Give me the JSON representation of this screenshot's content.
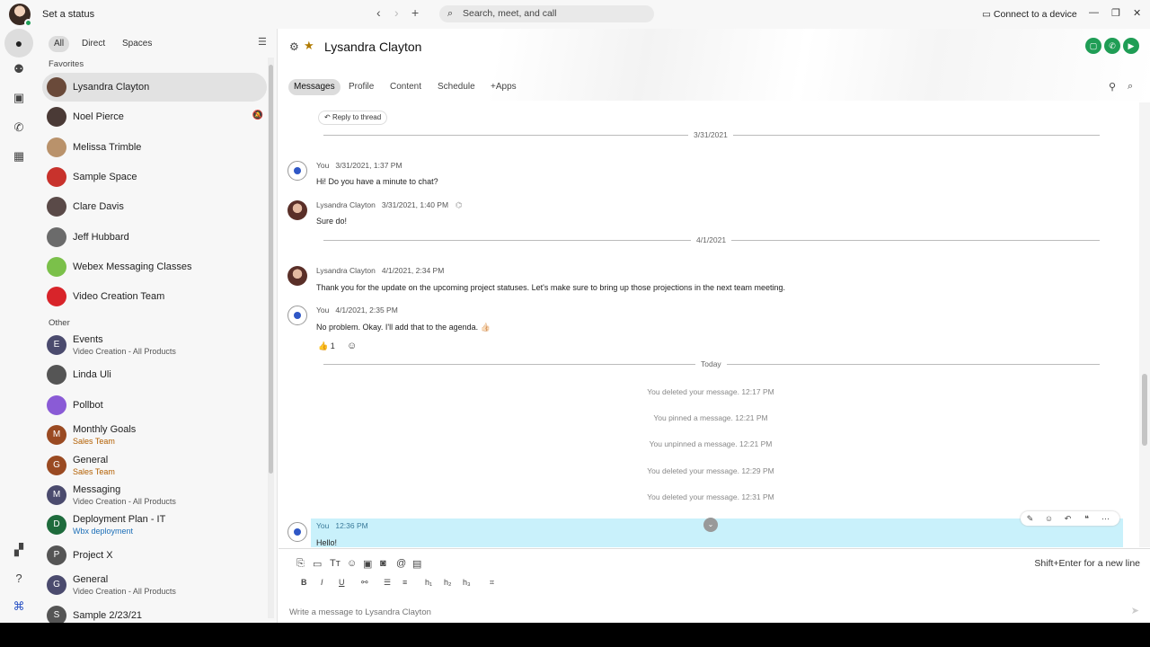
{
  "titlebar": {
    "set_status": "Set a status",
    "search_placeholder": "Search, meet, and call",
    "connect": "Connect to a device"
  },
  "sidebar": {
    "filters": [
      "All",
      "Direct",
      "Spaces"
    ],
    "favorites_label": "Favorites",
    "other_label": "Other",
    "favorites": [
      {
        "name": "Lysandra Clayton",
        "selected": true,
        "avatar_color": "#6a4a3a"
      },
      {
        "name": "Noel Pierce",
        "muted": true,
        "avatar_color": "#4a3a36"
      },
      {
        "name": "Melissa Trimble",
        "avatar_color": "#b9926b"
      },
      {
        "name": "Sample Space",
        "avatar_color": "#c8322c"
      },
      {
        "name": "Clare Davis",
        "avatar_color": "#5a4a48"
      },
      {
        "name": "Jeff Hubbard",
        "avatar_color": "#6b6b6b"
      },
      {
        "name": "Webex Messaging Classes",
        "avatar_color": "#7bc04a"
      },
      {
        "name": "Video Creation Team",
        "avatar_color": "#d8242a"
      }
    ],
    "other": [
      {
        "name": "Events",
        "sub": "Video Creation - All Products",
        "letter": "E",
        "avatar_color": "#4b4b6e",
        "sub_color": "plain"
      },
      {
        "name": "Linda Uli",
        "letter": "",
        "avatar_color": "#555555"
      },
      {
        "name": "Pollbot",
        "letter": "",
        "avatar_color": "#8a5bd6"
      },
      {
        "name": "Monthly Goals",
        "sub": "Sales Team",
        "letter": "M",
        "avatar_color": "#9a4a22",
        "sub_color": "orange"
      },
      {
        "name": "General",
        "sub": "Sales Team",
        "letter": "G",
        "avatar_color": "#9a4a22",
        "sub_color": "orange"
      },
      {
        "name": "Messaging",
        "sub": "Video Creation - All Products",
        "letter": "M",
        "avatar_color": "#4b4b6e",
        "sub_color": "plain"
      },
      {
        "name": "Deployment Plan - IT",
        "sub": "Wbx deployment",
        "letter": "D",
        "avatar_color": "#1e6b3c",
        "sub_color": "blue"
      },
      {
        "name": "Project X",
        "letter": "P",
        "avatar_color": "#555555"
      },
      {
        "name": "General",
        "sub": "Video Creation - All Products",
        "letter": "G",
        "avatar_color": "#4b4b6e",
        "sub_color": "plain"
      },
      {
        "name": "Sample 2/23/21",
        "letter": "S",
        "avatar_color": "#555555"
      }
    ]
  },
  "room": {
    "title": "Lysandra Clayton",
    "tabs": [
      "Messages",
      "Profile",
      "Content",
      "Schedule",
      "+Apps"
    ],
    "reply_thread": "Reply to thread",
    "dividers": [
      "3/31/2021",
      "4/1/2021",
      "Today"
    ],
    "messages": [
      {
        "author": "You",
        "time": "3/31/2021, 1:37 PM",
        "text": "Hi! Do you have a minute to chat?"
      },
      {
        "author": "Lysandra Clayton",
        "time": "3/31/2021, 1:40 PM",
        "text": "Sure do!"
      },
      {
        "author": "Lysandra Clayton",
        "time": "4/1/2021, 2:34 PM",
        "text": "Thank you for the update on the upcoming project statuses. Let's make sure to bring up those projections in the next team meeting."
      },
      {
        "author": "You",
        "time": "4/1/2021, 2:35 PM",
        "text": "No problem. Okay. I'll add that to the agenda. 👍🏻",
        "reaction": "👍 1"
      }
    ],
    "system": [
      "You deleted your message. 12:17 PM",
      "You pinned a message. 12:21 PM",
      "You unpinned a message. 12:21 PM",
      "You deleted your message. 12:29 PM",
      "You deleted your message. 12:31 PM"
    ],
    "last": {
      "author": "You",
      "time": "12:36 PM",
      "text": "Hello!"
    }
  },
  "composer": {
    "hint": "Shift+Enter for a new line",
    "placeholder": "Write a message to Lysandra Clayton"
  }
}
